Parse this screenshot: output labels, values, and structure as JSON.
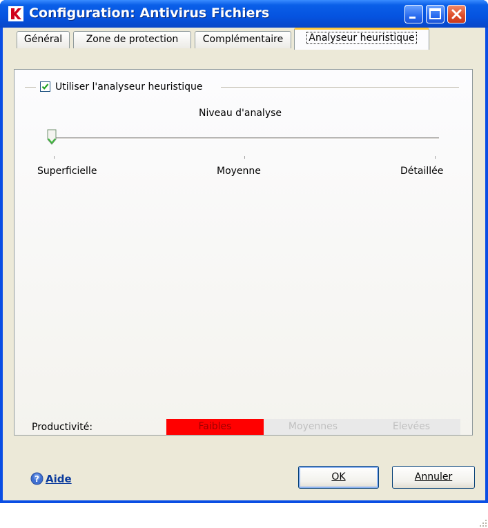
{
  "window": {
    "title": "Configuration: Antivirus Fichiers"
  },
  "tabs": [
    {
      "label": "Général"
    },
    {
      "label": "Zone de protection"
    },
    {
      "label": "Complémentaire"
    },
    {
      "label": "Analyseur heuristique"
    }
  ],
  "active_tab": "Analyseur heuristique",
  "heuristic": {
    "checkbox_label": "Utiliser l'analyseur heuristique",
    "checked": true,
    "level_title": "Niveau d'analyse",
    "level_options": [
      "Superficielle",
      "Moyenne",
      "Détaillée"
    ],
    "level_selected": "Superficielle"
  },
  "productivity": {
    "label": "Productivité:",
    "levels": [
      "Faibles",
      "Moyennes",
      "Elevées"
    ],
    "selected": "Faibles",
    "selected_color": "#ff0000"
  },
  "footer": {
    "help_label": "Aide",
    "ok_label": "OK",
    "cancel_label": "Annuler"
  },
  "icons": {
    "app": "kaspersky-k-icon",
    "help": "help-question-icon",
    "minimize": "minimize-icon",
    "maximize": "maximize-icon",
    "close": "close-icon"
  },
  "colors": {
    "titlebar": "#0553e0",
    "tab_active_accent": "#ffc83c",
    "link": "#0b3b9c"
  }
}
